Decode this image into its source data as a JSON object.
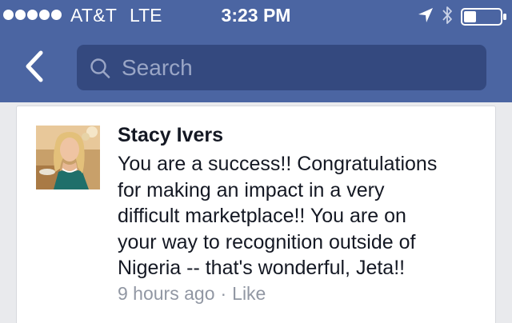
{
  "status_bar": {
    "carrier": "AT&T",
    "network": "LTE",
    "time": "3:23 PM",
    "signal_bars": 5,
    "icons": [
      "signal-dots-icon",
      "location-arrow-icon",
      "bluetooth-icon",
      "battery-icon"
    ]
  },
  "nav": {
    "back_icon": "chevron-left-icon",
    "search_placeholder": "Search",
    "search_icon": "search-icon"
  },
  "comment": {
    "author": "Stacy Ivers",
    "text": "You are a success!! Congratulations\nfor making an impact in a very\ndifficult marketplace!!  You are on\nyour way to recognition outside of\nNigeria -- that's wonderful, Jeta!!",
    "time_ago": "9 hours ago",
    "separator": "·",
    "like_label": "Like"
  },
  "colors": {
    "nav_background": "#4b65a2",
    "search_background": "#34497f",
    "page_background": "#e9eaed",
    "meta_text": "#9197a3"
  }
}
